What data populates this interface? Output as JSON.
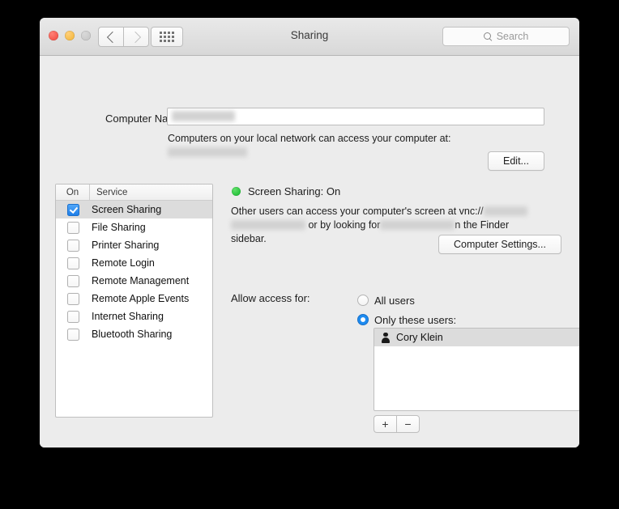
{
  "window": {
    "title": "Sharing",
    "traffic_lights": [
      "close-button",
      "minimize-button",
      "zoom-button"
    ],
    "nav": {
      "back": "back-chevron-icon",
      "forward": "forward-chevron-icon"
    },
    "show_all": "grid-icon"
  },
  "search": {
    "placeholder": "Search",
    "icon": "search-icon"
  },
  "computer_name": {
    "label": "Computer Name:",
    "value": "",
    "subtitle": "Computers on your local network can access your computer at:",
    "hostname": "",
    "edit_label": "Edit..."
  },
  "services": {
    "header": {
      "on": "On",
      "service": "Service"
    },
    "items": [
      {
        "label": "Screen Sharing",
        "checked": true,
        "selected": true
      },
      {
        "label": "File Sharing",
        "checked": false,
        "selected": false
      },
      {
        "label": "Printer Sharing",
        "checked": false,
        "selected": false
      },
      {
        "label": "Remote Login",
        "checked": false,
        "selected": false
      },
      {
        "label": "Remote Management",
        "checked": false,
        "selected": false
      },
      {
        "label": "Remote Apple Events",
        "checked": false,
        "selected": false
      },
      {
        "label": "Internet Sharing",
        "checked": false,
        "selected": false
      },
      {
        "label": "Bluetooth Sharing",
        "checked": false,
        "selected": false
      }
    ]
  },
  "detail": {
    "status_text": "Screen Sharing: On",
    "status_color": "#27c23c",
    "description_part1": "Other users can access your computer's screen at vnc://",
    "description_part2": "or by looking for",
    "description_part3": "n the Finder sidebar.",
    "computer_settings_label": "Computer Settings...",
    "allow_access_label": "Allow access for:",
    "radio_all_users": "All users",
    "radio_only_these_users": "Only these users:",
    "selected_radio": "only_these_users",
    "users": [
      {
        "name": "Cory Klein",
        "icon": "person-icon",
        "selected": true
      }
    ],
    "add_label": "+",
    "remove_label": "−"
  },
  "help": {
    "label": "?"
  }
}
